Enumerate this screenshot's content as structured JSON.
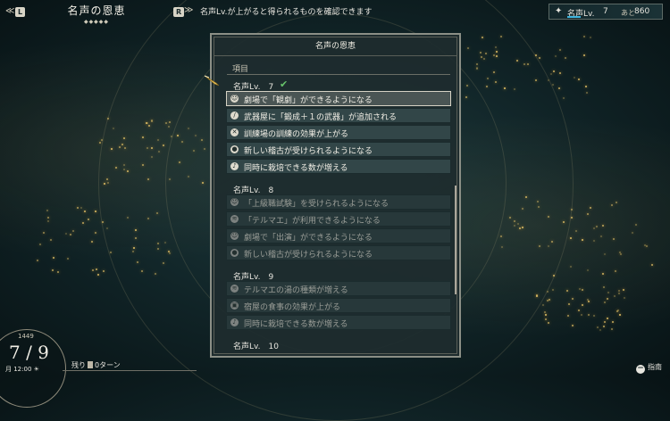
{
  "topbar": {
    "prev_arrow": "≪",
    "key_l": "L",
    "title": "名声の恩恵",
    "page_dots": "◆◆◆◆◆",
    "key_r": "R",
    "next_arrow": "≫",
    "hint": "名声Lv.が上がると得られるものを確認できます",
    "fame": {
      "star": "✦",
      "label": "名声Lv.",
      "level": "7",
      "next_label": "あと",
      "next_value": "860",
      "progress": 0.15
    }
  },
  "panel": {
    "header": "名声の恩恵",
    "column_header": "項目",
    "levels": [
      {
        "label": "名声Lv.　7",
        "achieved": true,
        "check": "✔",
        "items": [
          {
            "icon": "theater-icon",
            "glyph": "☺",
            "text": "劇場で「観劇」ができるようになる",
            "state": "selected"
          },
          {
            "icon": "weapon-icon",
            "glyph": "/",
            "text": "武器屋に「鍛成＋１の武器」が追加される",
            "state": "active"
          },
          {
            "icon": "training-icon",
            "glyph": "✕",
            "text": "訓練場の訓練の効果が上がる",
            "state": "active"
          },
          {
            "icon": "lesson-icon",
            "glyph": "●",
            "text": "新しい稽古が受けられるようになる",
            "state": "active"
          },
          {
            "icon": "farm-icon",
            "glyph": "♪",
            "text": "同時に栽培できる数が増える",
            "state": "active"
          }
        ]
      },
      {
        "label": "名声Lv.　8",
        "achieved": false,
        "items": [
          {
            "icon": "exam-icon",
            "glyph": "☺",
            "text": "「上級職試験」を受けられるようになる",
            "state": "locked"
          },
          {
            "icon": "bath-icon",
            "glyph": "≋",
            "text": "「テルマエ」が利用できるようになる",
            "state": "locked"
          },
          {
            "icon": "theater-icon",
            "glyph": "☺",
            "text": "劇場で「出演」ができるようになる",
            "state": "locked"
          },
          {
            "icon": "lesson-icon",
            "glyph": "●",
            "text": "新しい稽古が受けられるようになる",
            "state": "locked"
          }
        ]
      },
      {
        "label": "名声Lv.　9",
        "achieved": false,
        "items": [
          {
            "icon": "bath-icon",
            "glyph": "≋",
            "text": "テルマエの湯の種類が増える",
            "state": "locked"
          },
          {
            "icon": "inn-icon",
            "glyph": "▣",
            "text": "宿屋の食事の効果が上がる",
            "state": "locked"
          },
          {
            "icon": "farm-icon",
            "glyph": "♪",
            "text": "同時に栽培できる数が増える",
            "state": "locked"
          }
        ]
      },
      {
        "label": "名声Lv.　10",
        "achieved": false,
        "items": []
      }
    ]
  },
  "clock": {
    "year": "1449",
    "date": "7 / 9",
    "time": "月 12:00 ☀"
  },
  "turns": {
    "prefix": "残り",
    "value": "0",
    "suffix": "ターン"
  },
  "guide": {
    "button": "−",
    "label": "指南"
  },
  "colors": {
    "panel_bg": "#1e2c2e",
    "accent_check": "#67c36b",
    "fame_bar": "#3fb6e0",
    "selected_border": "#d6d2c4"
  }
}
